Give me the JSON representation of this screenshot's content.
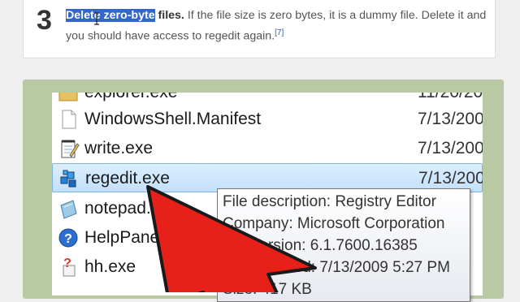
{
  "step": {
    "number": "3",
    "title": "Delete zero-byte",
    "title_rest": " files.",
    "description": " If the file size is zero bytes, it is a dummy file. Delete it and you should have access to regedit again.",
    "citation": "[7]"
  },
  "files": [
    {
      "name": "explorer.exe",
      "date": "11/20/20",
      "icon": "folder-app-icon"
    },
    {
      "name": "WindowsShell.Manifest",
      "date": "7/13/200",
      "icon": "document-icon"
    },
    {
      "name": "write.exe",
      "date": "7/13/200",
      "icon": "notepad-pen-icon"
    },
    {
      "name": "regedit.exe",
      "date": "7/13/200",
      "icon": "registry-cubes-icon",
      "selected": true
    },
    {
      "name": "notepad.exe",
      "date": "",
      "icon": "notepad-icon"
    },
    {
      "name": "HelpPane.exe",
      "date": "",
      "icon": "help-question-icon"
    },
    {
      "name": "hh.exe",
      "date": "",
      "icon": "help-document-icon"
    }
  ],
  "tooltip": {
    "description": "File description: Registry Editor",
    "company": "Company: Microsoft Corporation",
    "version": "File version: 6.1.7600.16385",
    "created": "Date created: 7/13/2009 5:27 PM",
    "size": "Size: 417 KB"
  },
  "colors": {
    "highlight": "#3366cc",
    "frame": "#b9c9a3",
    "arrow": "#e8201a"
  }
}
